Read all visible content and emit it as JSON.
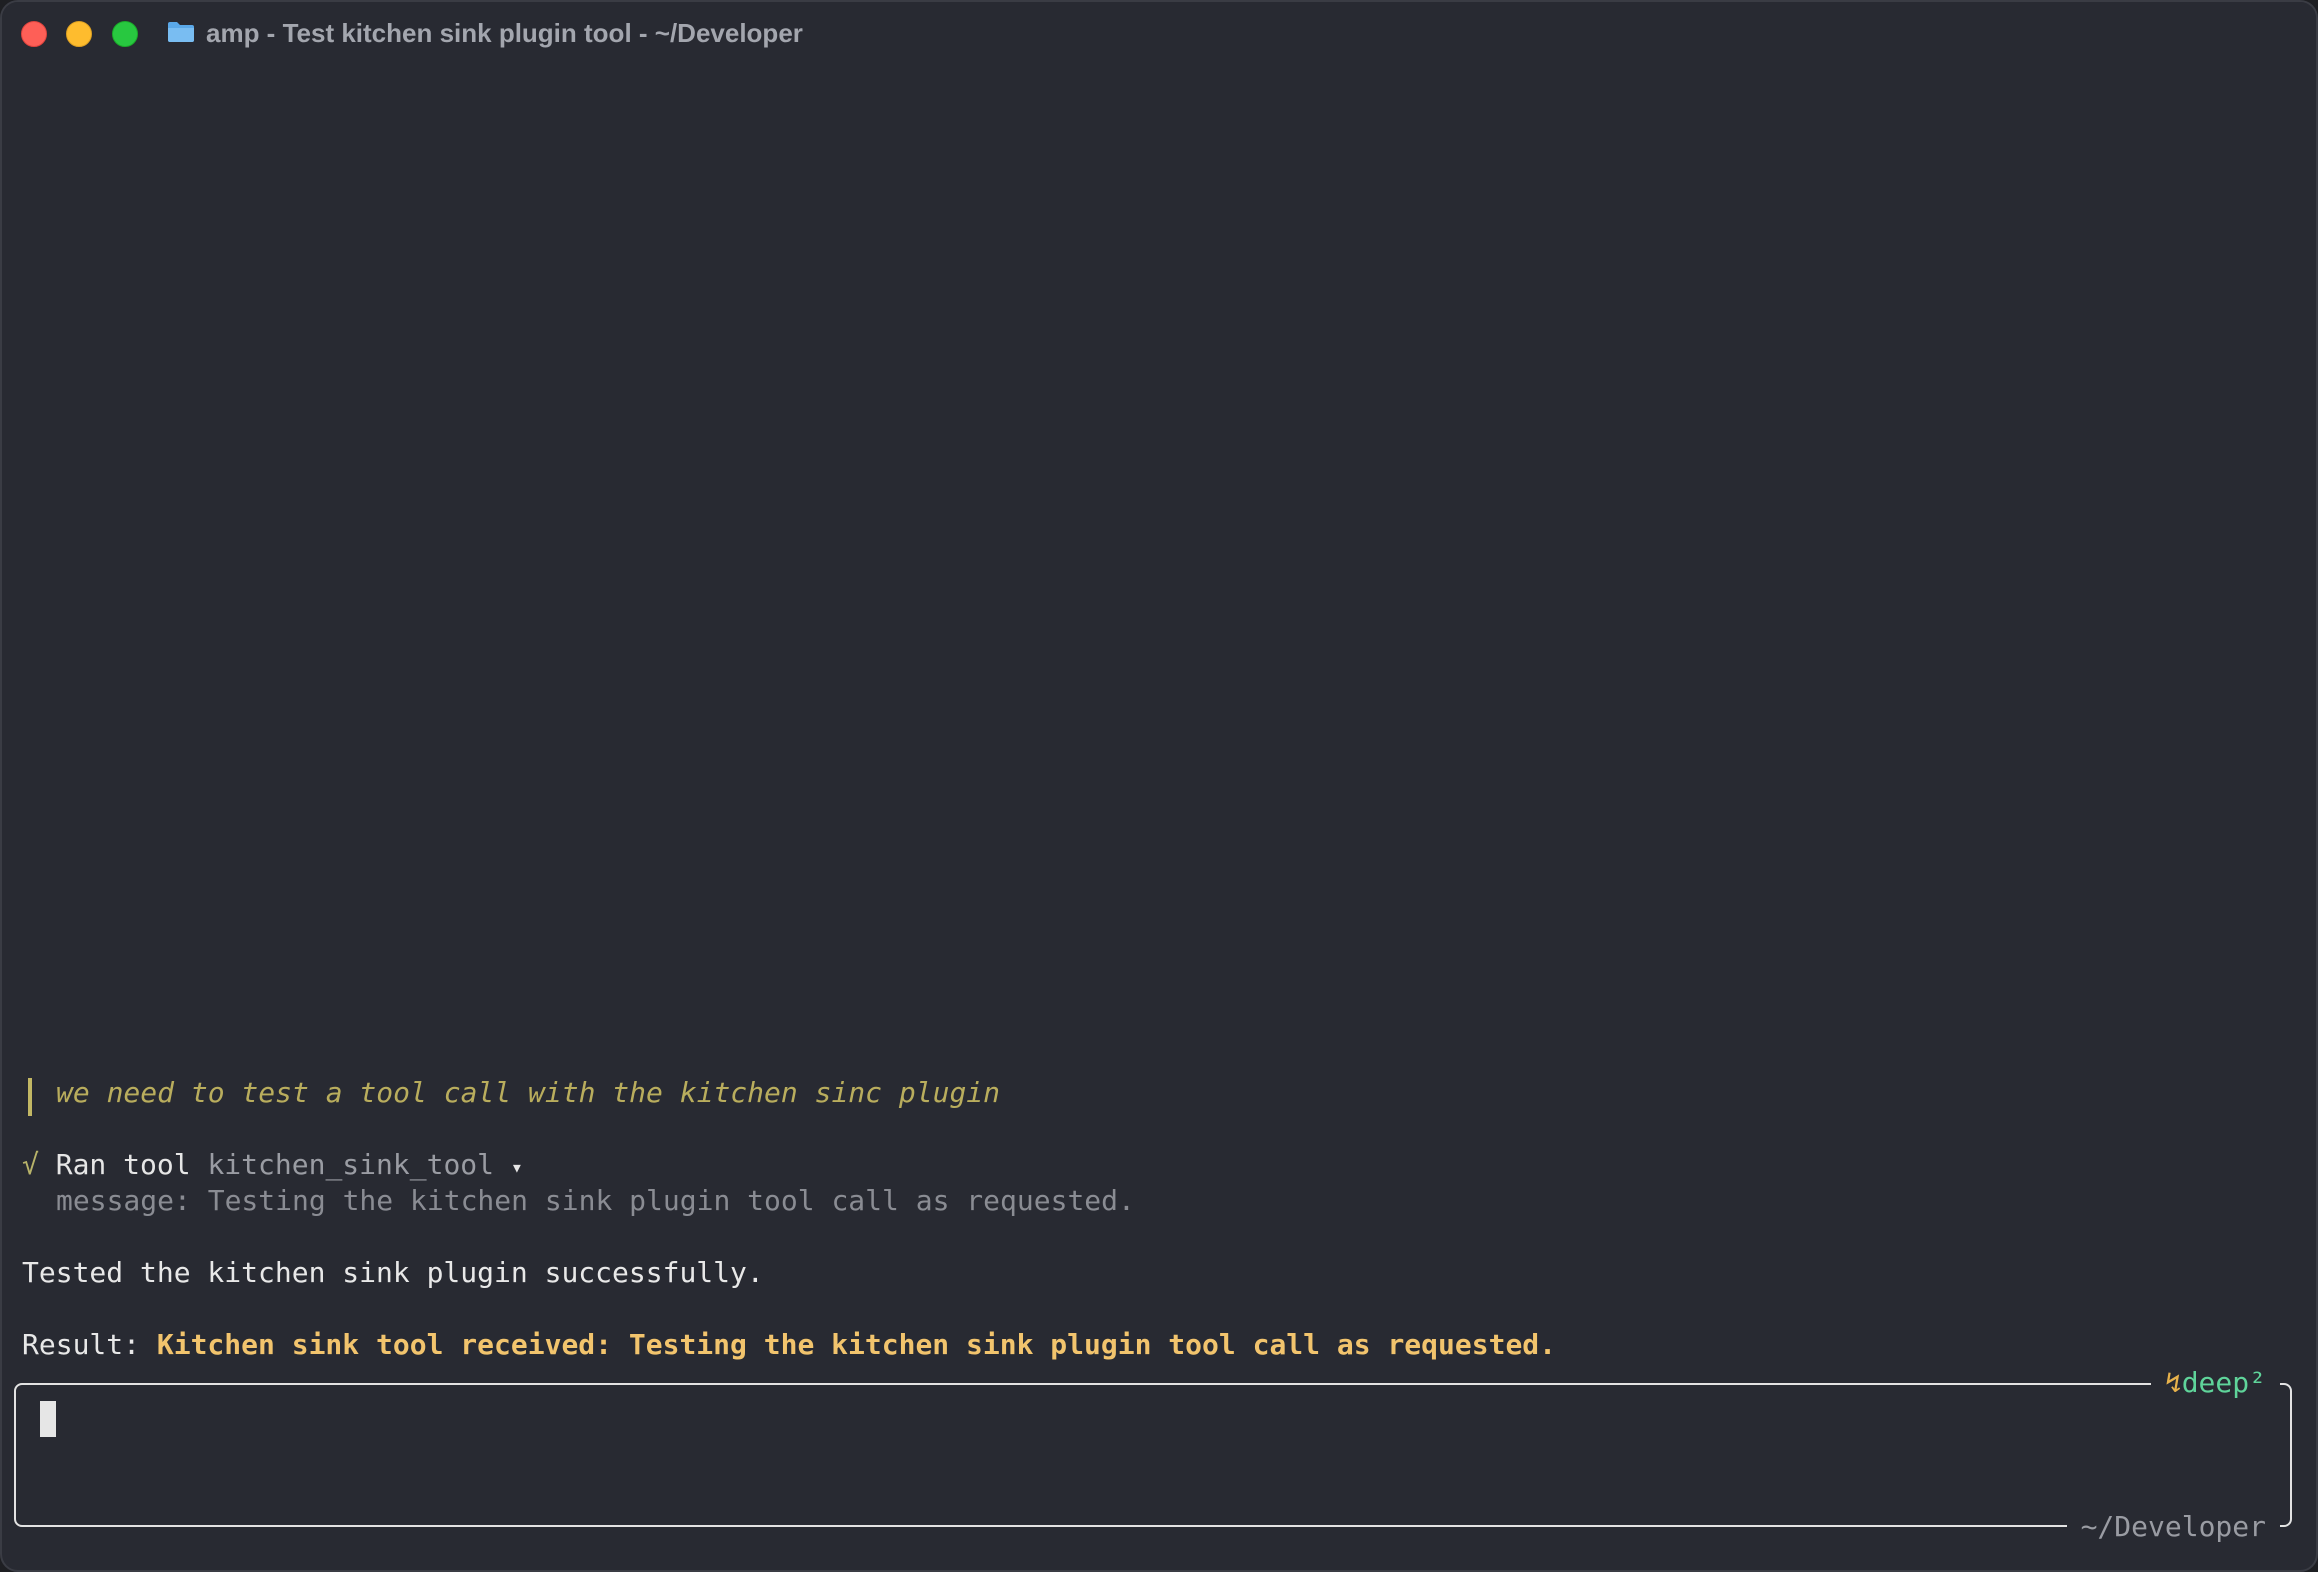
{
  "window": {
    "title": "amp - Test kitchen sink plugin tool - ~/Developer"
  },
  "transcript": {
    "user_message": "we need to test a tool call with the kitchen sinc plugin",
    "tool_call": {
      "status_icon": "√",
      "label": "Ran tool",
      "tool_name": "kitchen_sink_tool",
      "expand_icon": "▾",
      "message_line": "message: Testing the kitchen sink plugin tool call as requested."
    },
    "assistant_reply": "Tested the kitchen sink plugin successfully.",
    "result": {
      "label": "Result: ",
      "value": "Kitchen sink tool received: Testing the kitchen sink plugin tool call as requested."
    }
  },
  "input": {
    "value": "",
    "mode_icon": "↯",
    "mode_label": "deep²",
    "cwd": "~/Developer"
  },
  "colors": {
    "background": "#282a32",
    "user_message": "#b9ad5d",
    "result_value": "#f2c46d",
    "mode": "#5fd49a"
  }
}
